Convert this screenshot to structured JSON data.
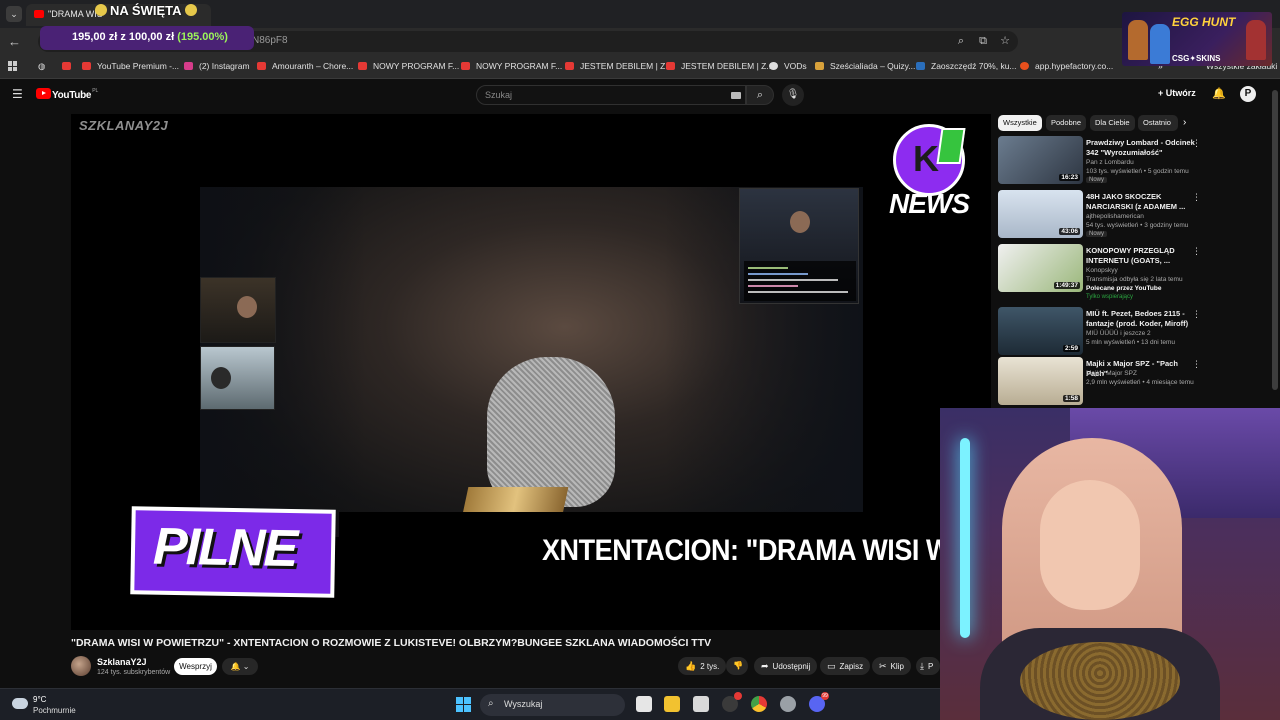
{
  "browser": {
    "active_tab_title": "\"DRAMA WIS",
    "overlay_title": "NA ŚWIĘTA",
    "url_fragment": "N86pF8",
    "donation_amount": "195,00 zł",
    "donation_connector": "z",
    "donation_goal": "100,00 zł",
    "donation_percent": "(195.00%)",
    "bookmarks": [
      "YouTube Premium -...",
      "(2) Instagram",
      "Amouranth – Chore...",
      "NOWY PROGRAM F...",
      "NOWY PROGRAM F...",
      "JESTEM DEBILEM | Z...",
      "JESTEM DEBILEM | Z...",
      "VODs",
      "Sześcialiada – Quizy...",
      "Zaoszczędź 70%, ku...",
      "app.hypefactory.co..."
    ],
    "all_bookmarks": "Wszystkie zakładki"
  },
  "ad": {
    "title": "EGG HUNT",
    "brand": "CSG✦SKINS"
  },
  "youtube": {
    "logo_text": "YouTube",
    "region": "PL",
    "search_placeholder": "Szukaj",
    "create_label": "Utwórz"
  },
  "player": {
    "watermark": "SZKLANAY2J",
    "news_word": "NEWS",
    "pilne": "PILNE",
    "ticker": "XNTENTACION: \"DRAMA WISI W"
  },
  "video": {
    "title": "\"DRAMA WISI W POWIETRZU\" - XNTENTACION O ROZMOWIE Z LUKISTEVE! OLBRZYM?BUNGEE SZKLANA WIADOMOŚCI TTV",
    "channel": "SzklanaY2J",
    "subscribers": "124 tys. subskrybentów",
    "support_label": "Wesprzyj",
    "likes": "2 tys.",
    "share_label": "Udostępnij",
    "save_label": "Zapisz",
    "clip_label": "Klip",
    "download_label": "P"
  },
  "sidebar": {
    "chips": [
      "Wszystkie",
      "Podobne",
      "Dla Ciebie",
      "Ostatnio"
    ],
    "recommendations": [
      {
        "title": "Prawdziwy Lombard - Odcinek 342 \"Wyrozumiałość\"",
        "channel": "Pan z Lombardu",
        "meta": "103 tys. wyświetleń • 5 godzin temu",
        "tag": "Nowy",
        "duration": "16:23"
      },
      {
        "title": "48H JAKO SKOCZEK NARCIARSKI (z ADAMEM ...",
        "channel": "ajthepolishamerican",
        "meta": "54 tys. wyświetleń • 3 godziny temu",
        "tag": "Nowy",
        "duration": "43:06"
      },
      {
        "title": "KONOPOWY PRZEGLĄD INTERNETU (GOATS, ...",
        "channel": "Konopskyy",
        "meta": "Transmisja odbyła się 2 lata temu",
        "tag": "Polecane przez YouTube",
        "member": "Tylko wspierający",
        "duration": "1:49:37"
      },
      {
        "title": "MIÜ ft. Pezet, Bedoes 2115 - fantazje (prod. Koder, Miroff)",
        "channel": "MIÜ ÜÜÜÜ i jeszcze 2",
        "meta": "5 mln wyświetleń • 13 dni temu",
        "tag": "",
        "duration": "2:59"
      },
      {
        "title": "Majki x Major SPZ - \"Pach Pach\"",
        "channel": "Majki i Major SPZ",
        "meta": "2,9 mln wyświetleń • 4 miesiące temu",
        "tag": "",
        "duration": "1:58"
      }
    ]
  },
  "taskbar": {
    "temperature": "9°C",
    "weather": "Pochmurnie",
    "search_label": "Wyszukaj",
    "discord_badge": "99"
  },
  "colors": {
    "accent_purple": "#7c2ae8",
    "youtube_red": "#ff0000",
    "donation_green": "#9cf55a",
    "news_green": "#36c43e"
  }
}
